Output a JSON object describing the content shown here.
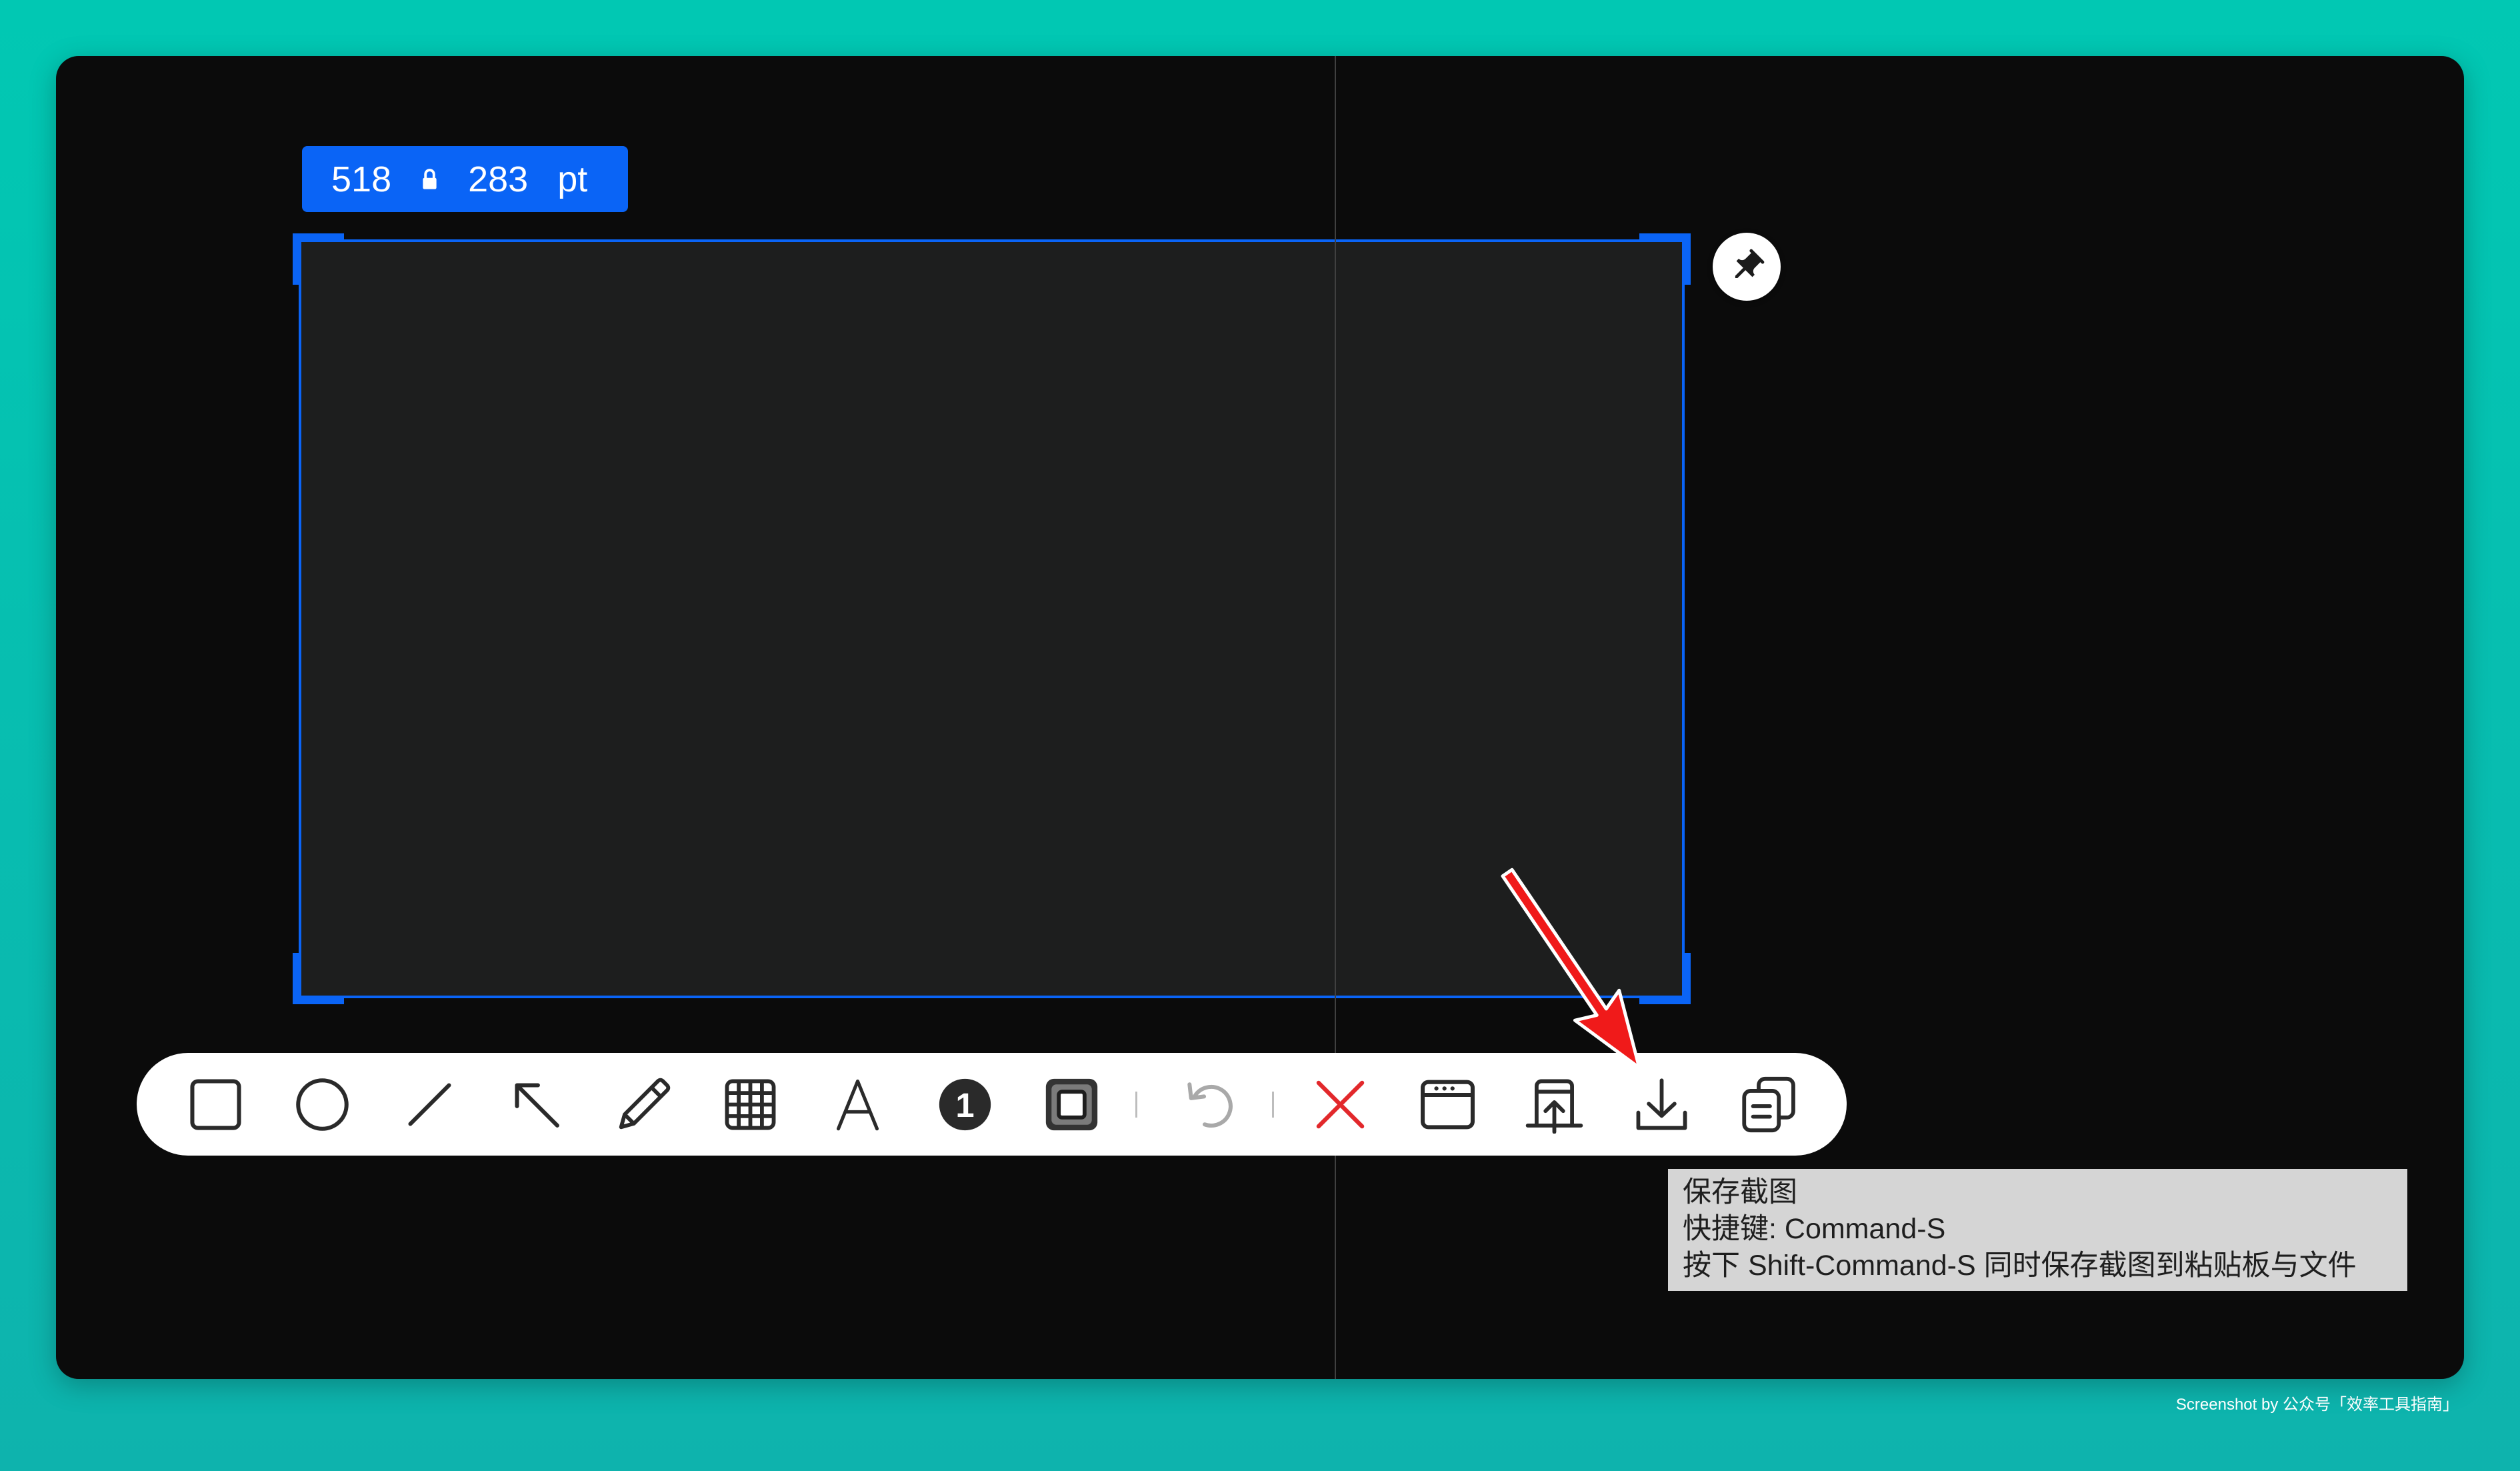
{
  "size_label": {
    "width": "518",
    "height": "283",
    "unit": "pt",
    "lock_icon": "lock-icon"
  },
  "pin": {
    "icon": "pin-icon"
  },
  "toolbar": {
    "tools": [
      "rectangle-icon",
      "ellipse-icon",
      "line-icon",
      "arrow-icon",
      "pencil-icon",
      "mosaic-icon",
      "text-icon",
      "counter-icon",
      "highlight-icon",
      "undo-icon",
      "cancel-icon",
      "window-icon",
      "upload-icon",
      "download-icon",
      "copy-icon"
    ],
    "counter_value": "1",
    "undo_enabled": false,
    "hovered_tool": "download-icon"
  },
  "tooltip": {
    "title": "保存截图",
    "shortcut": "快捷键: Command-S",
    "hint": "按下 Shift-Command-S 同时保存截图到粘贴板与文件"
  },
  "watermark": "Screenshot by 公众号「效率工具指南」",
  "colors": {
    "accent": "#0a64f6",
    "bg-top": "#01c8b3",
    "bg-bottom": "#0eb3ad",
    "canvas": "#0b0b0b",
    "selection-fill": "#1d1e1e",
    "tooltip-bg": "#d5d5d5",
    "arrow": "#f01a1a",
    "cancel": "#e2282b"
  }
}
